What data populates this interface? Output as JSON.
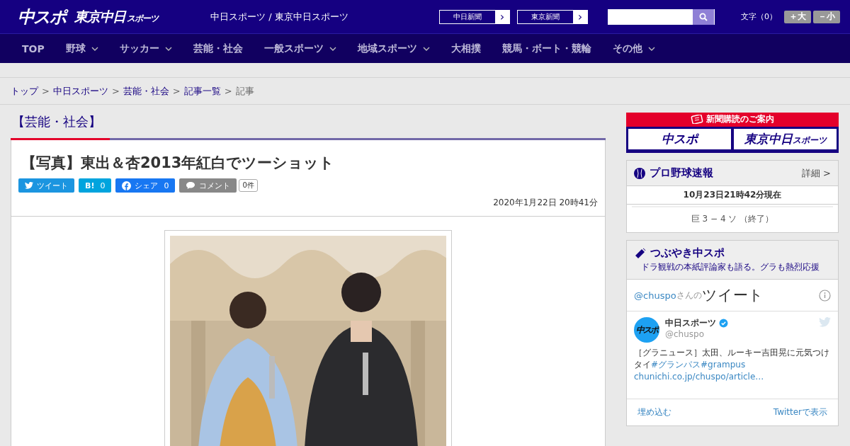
{
  "header": {
    "logo_main": "中スポ",
    "logo_sub": "東京中日",
    "logo_sub_small": "スポーツ",
    "site_title": "中日スポーツ / 東京中日スポーツ",
    "site_links": [
      {
        "label": "中日新聞",
        "arrow": "›"
      },
      {
        "label": "東京新聞",
        "arrow": "›"
      }
    ],
    "font_size_label": "文字（0）",
    "font_buttons": [
      "＋大",
      "－小"
    ]
  },
  "nav": [
    {
      "label": "TOP",
      "dropdown": false
    },
    {
      "label": "野球",
      "dropdown": true
    },
    {
      "label": "サッカー",
      "dropdown": true
    },
    {
      "label": "芸能・社会",
      "dropdown": false
    },
    {
      "label": "一般スポーツ",
      "dropdown": true
    },
    {
      "label": "地域スポーツ",
      "dropdown": true
    },
    {
      "label": "大相撲",
      "dropdown": false
    },
    {
      "label": "競馬・ボート・競輪",
      "dropdown": false
    },
    {
      "label": "その他",
      "dropdown": true
    }
  ],
  "breadcrumb": [
    {
      "label": "トップ",
      "link": true
    },
    {
      "label": "中日スポーツ",
      "link": true
    },
    {
      "label": "芸能・社会",
      "link": true
    },
    {
      "label": "記事一覧",
      "link": true
    },
    {
      "label": "記事",
      "link": false
    }
  ],
  "breadcrumb_separator": ">",
  "section_title": "【芸能・社会】",
  "article": {
    "title": "【写真】東出＆杏2013年紅白でツーショット",
    "share": [
      {
        "kind": "twitter",
        "label": "ツイート"
      },
      {
        "kind": "hatena",
        "label": "B!",
        "count": "0"
      },
      {
        "kind": "facebook",
        "label": "シェア",
        "count": "0"
      },
      {
        "kind": "comment",
        "label": "コメント",
        "count": "0件"
      }
    ],
    "date": "2020年1月22日 20時41分"
  },
  "sidebar": {
    "subscribe": {
      "title": "新聞購読のご案内",
      "logos": [
        "中スポ",
        "東京中日"
      ],
      "logo_small": "スポーツ"
    },
    "baseball": {
      "title": "プロ野球速報",
      "detail": "詳細 >",
      "timestamp": "10月23日21時42分現在",
      "score": "巨 3 − 4 ソ （終了）"
    },
    "tweets": {
      "title": "つぶやき中スポ",
      "subtitle": "ドラ観戦の本紙評論家も語る。グラも熱烈応援",
      "handle": "@chuspo",
      "handle_suffix": "さんの",
      "heading": "ツイート",
      "tweet": {
        "avatar": "中スポ",
        "name": "中日スポーツ",
        "user": "@chuspo",
        "text": "［グラニュース］太田、ルーキー吉田晃に元気つけタイ",
        "hashtags": [
          "#グランパス",
          "#grampus"
        ],
        "link": "chunichi.co.jp/chuspo/article…"
      },
      "embed": "埋め込む",
      "view": "Twitterで表示"
    }
  }
}
